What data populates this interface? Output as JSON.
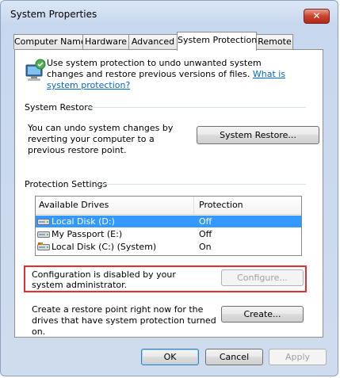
{
  "window": {
    "title": "System Properties",
    "close_glyph": "✕"
  },
  "tabs": [
    {
      "label": "Computer Name"
    },
    {
      "label": "Hardware"
    },
    {
      "label": "Advanced"
    },
    {
      "label": "System Protection"
    },
    {
      "label": "Remote"
    }
  ],
  "intro": {
    "text": "Use system protection to undo unwanted system changes and restore previous versions of files.",
    "link": "What is system protection?"
  },
  "system_restore": {
    "group_label": "System Restore",
    "description": "You can undo system changes by reverting your computer to a previous restore point.",
    "button": "System Restore..."
  },
  "protection_settings": {
    "group_label": "Protection Settings",
    "columns": [
      "Available Drives",
      "Protection"
    ],
    "drives": [
      {
        "name": "Local Disk (D:)",
        "protection": "Off",
        "selected": true,
        "icon": "hard-drive-icon"
      },
      {
        "name": "My Passport (E:)",
        "protection": "Off",
        "selected": false,
        "icon": "hard-drive-icon"
      },
      {
        "name": "Local Disk (C:) (System)",
        "protection": "On",
        "selected": false,
        "icon": "system-drive-icon"
      }
    ],
    "config_message": "Configuration is disabled by your system administrator.",
    "configure_button": "Configure...",
    "create_text": "Create a restore point right now for the drives that have system protection turned on.",
    "create_button": "Create..."
  },
  "footer": {
    "ok": "OK",
    "cancel": "Cancel",
    "apply": "Apply"
  },
  "colors": {
    "selection": "#3399ff",
    "link": "#0066cc",
    "highlight_box": "#e03030"
  }
}
